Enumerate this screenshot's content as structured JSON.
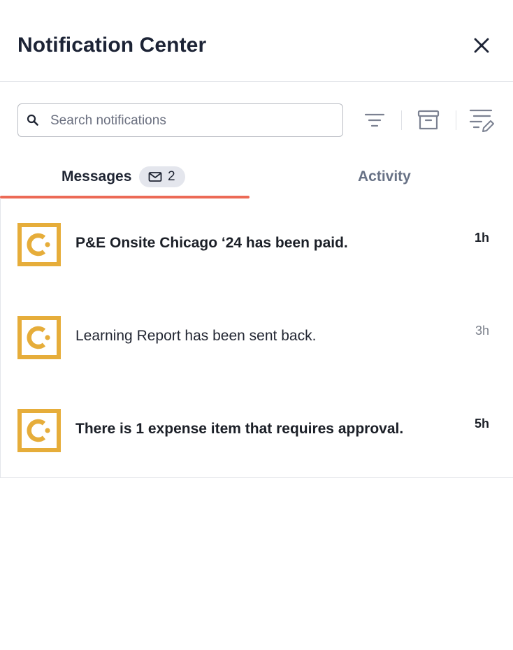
{
  "header": {
    "title": "Notification Center",
    "close_icon": "close-icon"
  },
  "search": {
    "placeholder": "Search notifications",
    "value": ""
  },
  "toolbar": {
    "filter_icon": "filter-icon",
    "archive_icon": "archive-icon",
    "edit_list_icon": "edit-list-icon"
  },
  "tabs": {
    "messages": {
      "label": "Messages",
      "count": "2",
      "icon": "mail-icon",
      "selected": true
    },
    "activity": {
      "label": "Activity",
      "selected": false
    }
  },
  "notifications": [
    {
      "text": "P&E Onsite Chicago ‘24 has been paid.",
      "time": "1h",
      "unread": true
    },
    {
      "text": "Learning Report has been sent back.",
      "time": "3h",
      "unread": false
    },
    {
      "text": "There is 1 expense item that requires approval.",
      "time": "5h",
      "unread": true
    }
  ],
  "colors": {
    "accent_underline": "#ec6a56",
    "logo_gold": "#e6ad3a",
    "title_text": "#1c2335",
    "muted_text": "#687286"
  }
}
